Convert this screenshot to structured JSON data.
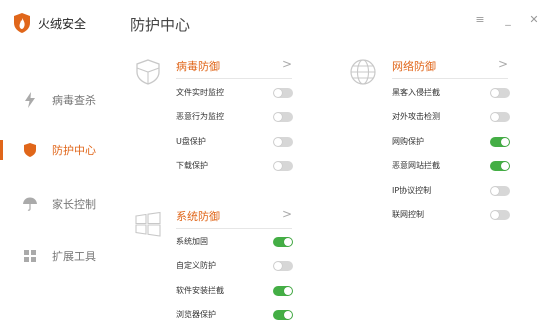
{
  "app": {
    "name": "火绒安全",
    "page_title": "防护中心"
  },
  "colors": {
    "accent": "#e0661a",
    "toggle_on": "#44ae45",
    "toggle_off": "#d7d7d7"
  },
  "sidebar": {
    "items": [
      {
        "label": "病毒查杀",
        "icon": "lightning-icon",
        "active": false
      },
      {
        "label": "防护中心",
        "icon": "shield-icon",
        "active": true
      },
      {
        "label": "家长控制",
        "icon": "umbrella-icon",
        "active": false
      },
      {
        "label": "扩展工具",
        "icon": "grid-icon",
        "active": false
      }
    ]
  },
  "window_controls": {
    "menu": "≡",
    "minimize": "_",
    "close": "✕"
  },
  "sections": {
    "virus": {
      "title": "病毒防御",
      "chevron": ">",
      "icon": "shield-outline-icon",
      "items": [
        {
          "label": "文件实时监控",
          "on": false
        },
        {
          "label": "恶意行为监控",
          "on": false
        },
        {
          "label": "U盘保护",
          "on": false
        },
        {
          "label": "下载保护",
          "on": false
        }
      ]
    },
    "system": {
      "title": "系统防御",
      "chevron": ">",
      "icon": "windows-icon",
      "items": [
        {
          "label": "系统加固",
          "on": true
        },
        {
          "label": "自定义防护",
          "on": false
        },
        {
          "label": "软件安装拦截",
          "on": true
        },
        {
          "label": "浏览器保护",
          "on": true
        }
      ]
    },
    "network": {
      "title": "网络防御",
      "chevron": ">",
      "icon": "globe-icon",
      "items": [
        {
          "label": "黑客入侵拦截",
          "on": false
        },
        {
          "label": "对外攻击检测",
          "on": false
        },
        {
          "label": "网购保护",
          "on": true
        },
        {
          "label": "恶意网站拦截",
          "on": true
        },
        {
          "label": "IP协议控制",
          "on": false
        },
        {
          "label": "联网控制",
          "on": false
        }
      ]
    }
  }
}
